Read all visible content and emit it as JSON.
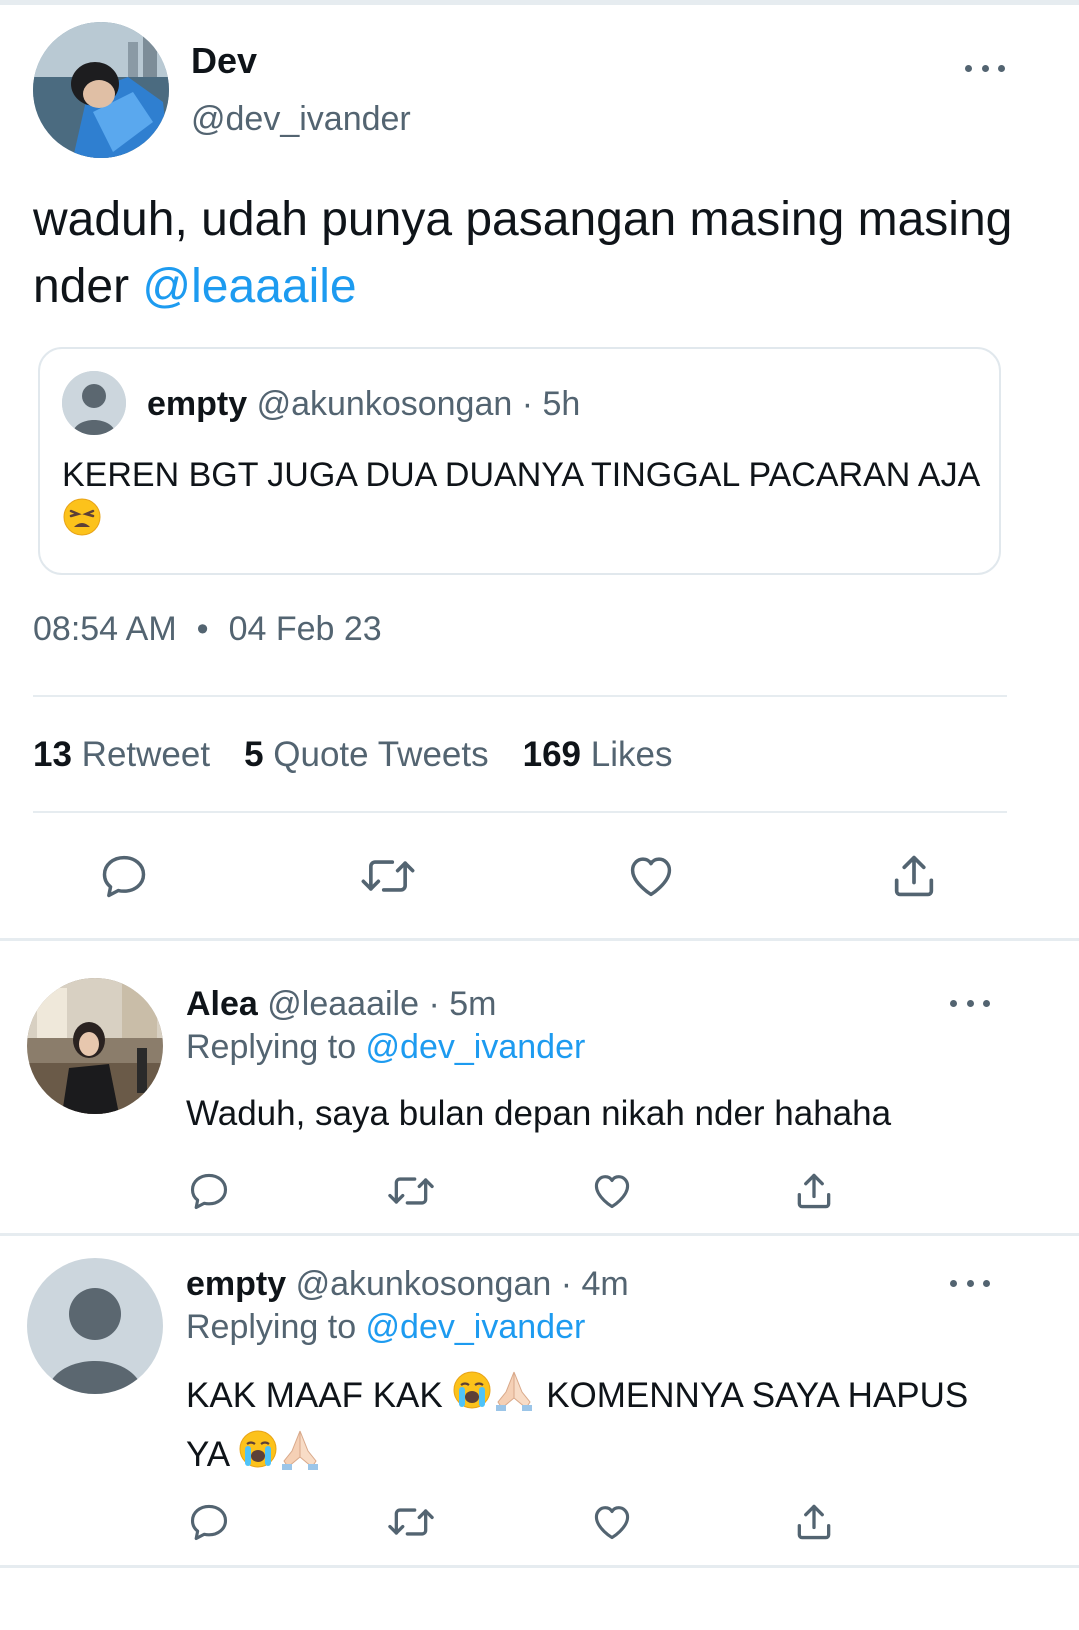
{
  "main_tweet": {
    "name": "Dev",
    "handle": "@dev_ivander",
    "text": "waduh, udah punya pasangan masing masing nder ",
    "mention": "@leaaaile",
    "quoted": {
      "name": "empty",
      "handle_time": " @akunkosongan · 5h",
      "text": "KEREN BGT JUGA DUA DUANYA TINGGAL PACARAN AJA"
    },
    "time": "08:54 AM",
    "separator": "•",
    "date": "04 Feb 23",
    "stats": {
      "retweets": "13",
      "retweets_label": "Retweet",
      "quotes": "5",
      "quotes_label": "Quote Tweets",
      "likes": "169",
      "likes_label": "Likes"
    }
  },
  "replies": [
    {
      "name": "Alea",
      "handle_time": " @leaaaile · 5m",
      "replying_label": "Replying to ",
      "replying_to": "@dev_ivander",
      "text": "Waduh, saya bulan depan nikah nder hahaha"
    },
    {
      "name": "empty",
      "handle_time": " @akunkosongan · 4m",
      "replying_label": "Replying to ",
      "replying_to": "@dev_ivander",
      "text_line1": "KAK MAAF KAK ",
      "text_line1b": " KOMENNYA SAYA HAPUS",
      "text_line2": "YA "
    }
  ],
  "colors": {
    "accent": "#1d9bf0",
    "secondary_text": "#536471",
    "divider": "#e6ecf0"
  },
  "icons": [
    "more-icon",
    "reply-icon",
    "retweet-icon",
    "like-icon",
    "share-icon",
    "tired-face-emoji",
    "crying-face-emoji",
    "folded-hands-emoji"
  ]
}
